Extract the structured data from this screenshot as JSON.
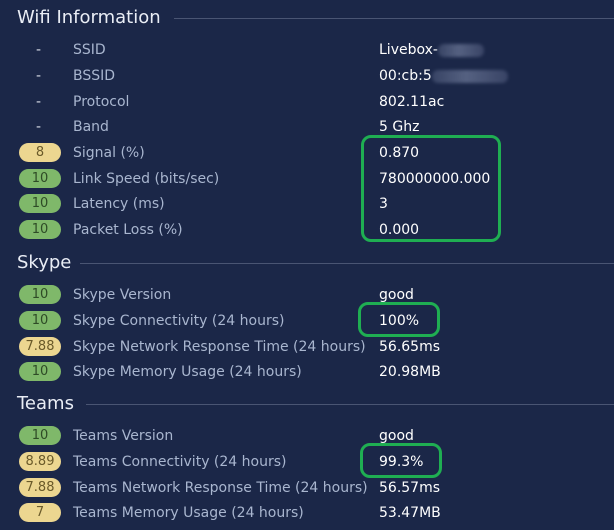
{
  "sections": {
    "wifi": {
      "title": "Wifi Information",
      "rows": [
        {
          "marker": "-",
          "label": "SSID",
          "value": "Livebox-"
        },
        {
          "marker": "-",
          "label": "BSSID",
          "value": "00:cb:5"
        },
        {
          "marker": "-",
          "label": "Protocol",
          "value": "802.11ac"
        },
        {
          "marker": "-",
          "label": "Band",
          "value": "5 Ghz"
        },
        {
          "score": "8",
          "label": "Signal (%)",
          "value": "0.870",
          "status": "yellow"
        },
        {
          "score": "10",
          "label": "Link Speed (bits/sec)",
          "value": "780000000.000",
          "status": "green"
        },
        {
          "score": "10",
          "label": "Latency (ms)",
          "value": "3",
          "status": "green"
        },
        {
          "score": "10",
          "label": "Packet Loss (%)",
          "value": "0.000",
          "status": "green"
        }
      ]
    },
    "skype": {
      "title": "Skype",
      "rows": [
        {
          "score": "10",
          "label": "Skype Version",
          "value": "good",
          "status": "green"
        },
        {
          "score": "10",
          "label": "Skype Connectivity (24 hours)",
          "value": "100%",
          "status": "green"
        },
        {
          "score": "7.88",
          "label": "Skype Network Response Time (24 hours)",
          "value": "56.65ms",
          "status": "yellow"
        },
        {
          "score": "10",
          "label": "Skype Memory Usage (24 hours)",
          "value": "20.98MB",
          "status": "green"
        }
      ]
    },
    "teams": {
      "title": "Teams",
      "rows": [
        {
          "score": "10",
          "label": "Teams Version",
          "value": "good",
          "status": "green"
        },
        {
          "score": "8.89",
          "label": "Teams Connectivity (24 hours)",
          "value": "99.3%",
          "status": "yellow"
        },
        {
          "score": "7.88",
          "label": "Teams Network Response Time (24 hours)",
          "value": "56.57ms",
          "status": "yellow"
        },
        {
          "score": "7",
          "label": "Teams Memory Usage (24 hours)",
          "value": "53.47MB",
          "status": "yellow"
        }
      ]
    }
  },
  "colors": {
    "background": "#1b2748",
    "badge_green": "#7fb86a",
    "badge_yellow": "#ecd690",
    "highlight": "#1fae52"
  }
}
